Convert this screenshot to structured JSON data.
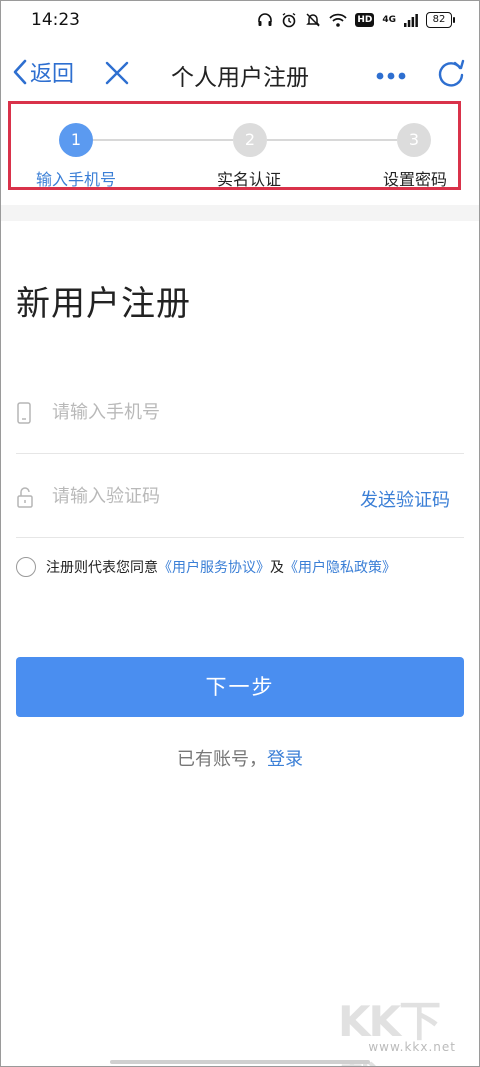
{
  "status_bar": {
    "time": "14:23",
    "network_label": "4G",
    "hd_label": "HD",
    "battery": "82"
  },
  "nav": {
    "back_label": "返回",
    "title": "个人用户注册"
  },
  "steps": [
    {
      "number": "1",
      "label": "输入手机号",
      "state": "active"
    },
    {
      "number": "2",
      "label": "实名认证",
      "state": "inactive"
    },
    {
      "number": "3",
      "label": "设置密码",
      "state": "inactive"
    }
  ],
  "form": {
    "heading": "新用户注册",
    "phone_placeholder": "请输入手机号",
    "code_placeholder": "请输入验证码",
    "send_code_label": "发送验证码"
  },
  "agreement": {
    "prefix": "注册则代表您同意",
    "service_link": "《用户服务协议》",
    "conjunction": "及",
    "privacy_link": "《用户隐私政策》"
  },
  "actions": {
    "next_label": "下一步",
    "has_account": "已有账号，",
    "login_label": "登录"
  },
  "watermark": {
    "logo": "KK下载",
    "url": "www.kkx.net"
  },
  "colors": {
    "accent": "#3b7fd6",
    "button": "#4a8ef0",
    "step_active": "#5b9af0",
    "step_inactive": "#dcdcdc",
    "highlight_box": "#d9324a"
  }
}
